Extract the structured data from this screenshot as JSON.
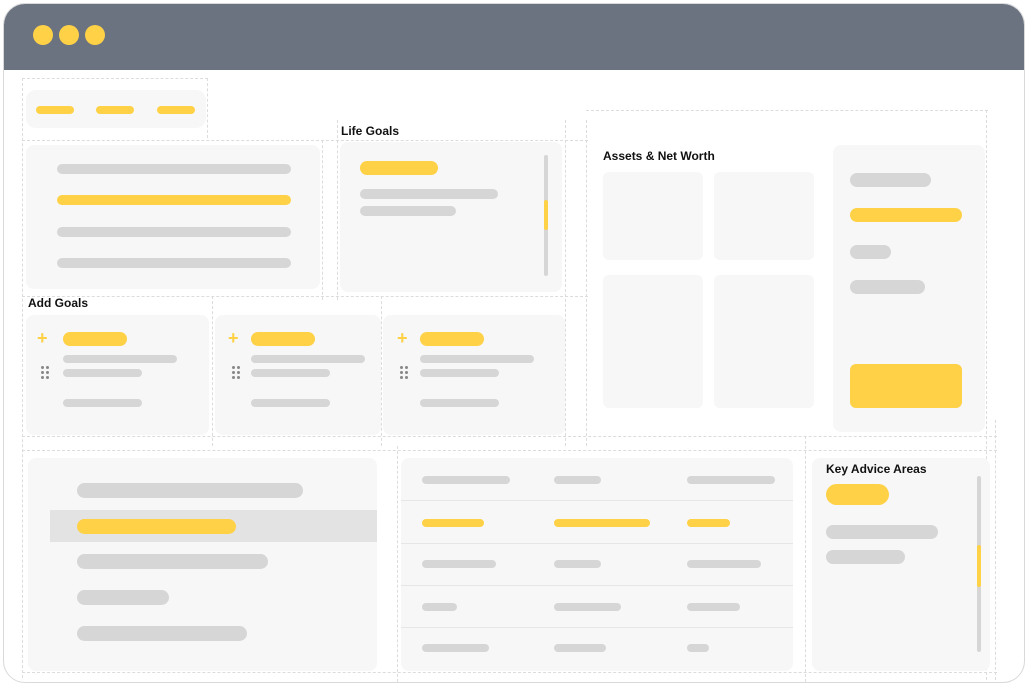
{
  "window": {
    "accent": "#fed147",
    "titlebar_color": "#6b7280"
  },
  "sections": {
    "life_goals": "Life Goals",
    "assets_net_worth": "Assets & Net Worth",
    "add_goals": "Add Goals",
    "key_advice_areas": "Key Advice Areas"
  },
  "icons": {
    "add": "plus-icon",
    "drag": "drag-handle-icon"
  }
}
